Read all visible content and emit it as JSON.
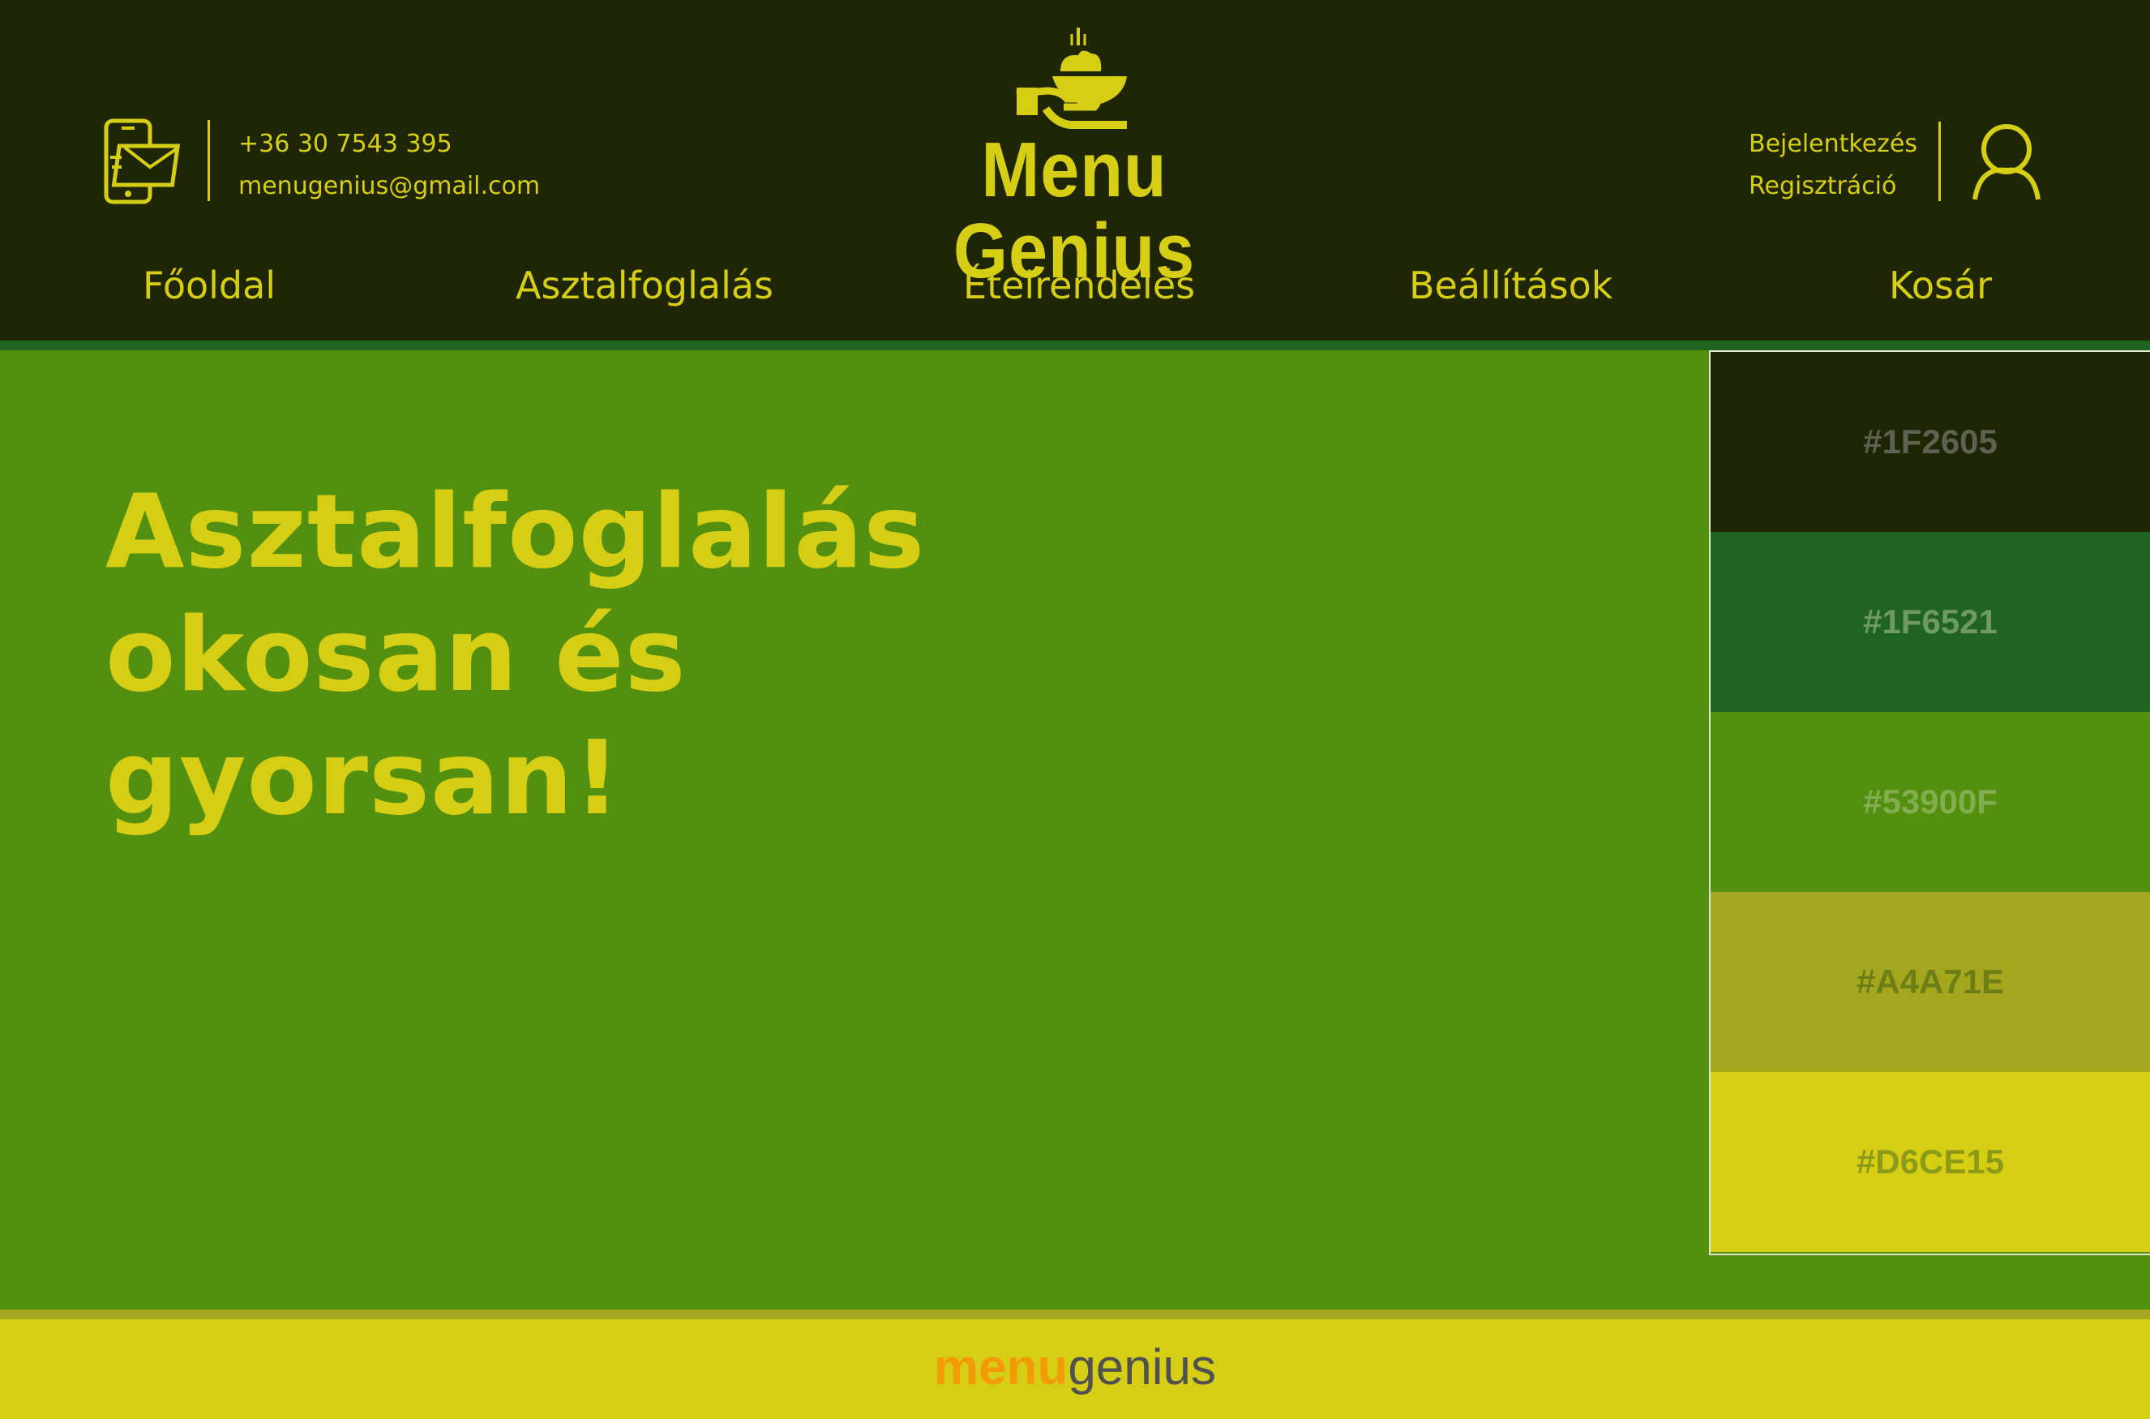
{
  "header": {
    "phone": "+36 30 7543 395",
    "email": "menugenius@gmail.com",
    "logo_text": "Menu Genius",
    "login": "Bejelentkezés",
    "register": "Regisztráció"
  },
  "nav": {
    "items": [
      "Főoldal",
      "Asztalfoglalás",
      "Ételrendelés",
      "Beállítások",
      "Kosár"
    ]
  },
  "hero": {
    "title": "Asztalfoglalás\nokosan és\ngyorsan!"
  },
  "palette": [
    {
      "label": "#1F2605",
      "color": "#1F2605",
      "text_color": "#5f6151"
    },
    {
      "label": "#1F6521",
      "color": "#1F6521",
      "text_color": "#6f9a62"
    },
    {
      "label": "#53900F",
      "color": "#53900F",
      "text_color": "#84ad50"
    },
    {
      "label": "#A4A71E",
      "color": "#A4A71E",
      "text_color": "#6e7e16"
    },
    {
      "label": "#D6CE15",
      "color": "#D6CE15",
      "text_color": "#8d9a18"
    }
  ],
  "footer": {
    "logo_part1": "menu",
    "logo_part2": "genius"
  },
  "colors": {
    "header_bg": "#1F2605",
    "accent": "#D6CE15",
    "main_bg": "#53900F",
    "divider": "#1F6521",
    "footer_bg": "#D6CE15",
    "footer_logo_orange": "#F39A08"
  }
}
